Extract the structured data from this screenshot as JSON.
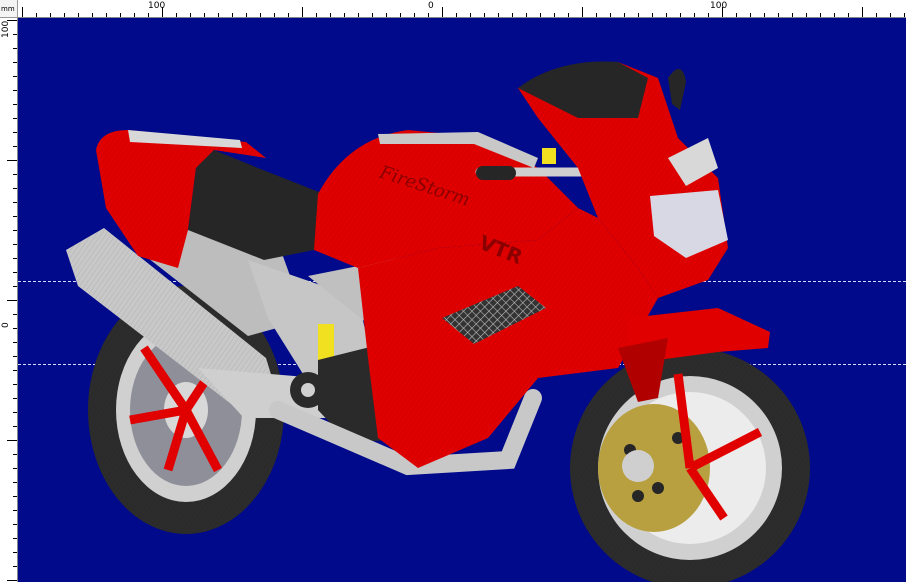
{
  "ruler": {
    "unit": "mm",
    "top_labels": [
      "100",
      "0",
      "100"
    ],
    "left_labels": [
      "100",
      "0"
    ]
  },
  "colors": {
    "canvas": "#000a8a",
    "body_red": "#e00000",
    "dark": "#262626",
    "silver": "#c4c4c4",
    "gold": "#b8a040",
    "yellow": "#f0e020"
  },
  "design": {
    "logo_text": "FireStorm",
    "fairing_text": "VTR"
  }
}
